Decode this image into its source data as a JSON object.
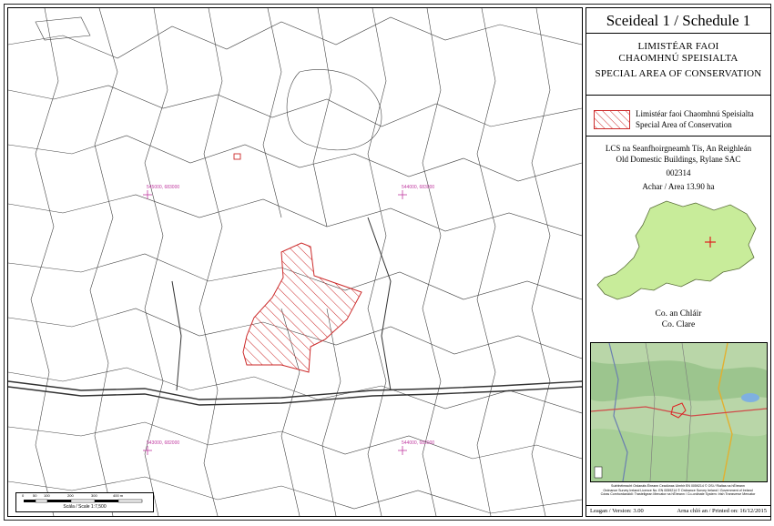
{
  "title": "Sceideal 1 / Schedule 1",
  "designation": {
    "line1": "LIMISTÉAR FAOI",
    "line2": "CHAOMHNÚ SPEISIALTA",
    "line3": "SPECIAL AREA OF CONSERVATION"
  },
  "legend": {
    "label_ga": "Limistéar faoi Chaomhnú Speisialta",
    "label_en": "Special Area of Conservation",
    "swatch_color": "#cc2a2a"
  },
  "site": {
    "name_ga": "LCS na Seanfhoirgneamh Tís, An Reighleán",
    "name_en": "Old Domestic Buildings, Rylane SAC",
    "code": "002314",
    "area": "Achar / Area  13.90 ha"
  },
  "county": {
    "name_ga": "Co. an Chláir",
    "name_en": "Co. Clare"
  },
  "grid_coords": {
    "top_left": "545000, 683000",
    "top_right": "544000, 683000",
    "bottom_left": "543000, 682000",
    "bottom_right": "544000, 682000"
  },
  "scale": {
    "label": "Scála / Scale 1:7,500",
    "ticks": [
      "0",
      "50",
      "100",
      "200",
      "300",
      "400 m"
    ]
  },
  "copyright": {
    "line1": "Suirbhéireacht Ordanáis Éireann Ceadúnas Uimhir EN 0059214 © OSi / Rialtas na hÉireann",
    "line2": "Ordnance Survey Ireland Licence No. EN 0059214 © Ordnance Survey Ireland / Government of Ireland",
    "line3": "Córas Comhordanáidí: Trasteilgean Mercator na hÉireann / Co-ordinate System: Irish Transverse Mercator"
  },
  "footer": {
    "version": "Leagan / Version: 3.00",
    "printed": "Arna chló an / Printed on: 16/12/2015"
  },
  "colors": {
    "sac_hatch": "#cc2a2a",
    "grid_label": "#c03aa0",
    "county_fill": "#c8ec9a",
    "county_marker": "#e02020"
  }
}
